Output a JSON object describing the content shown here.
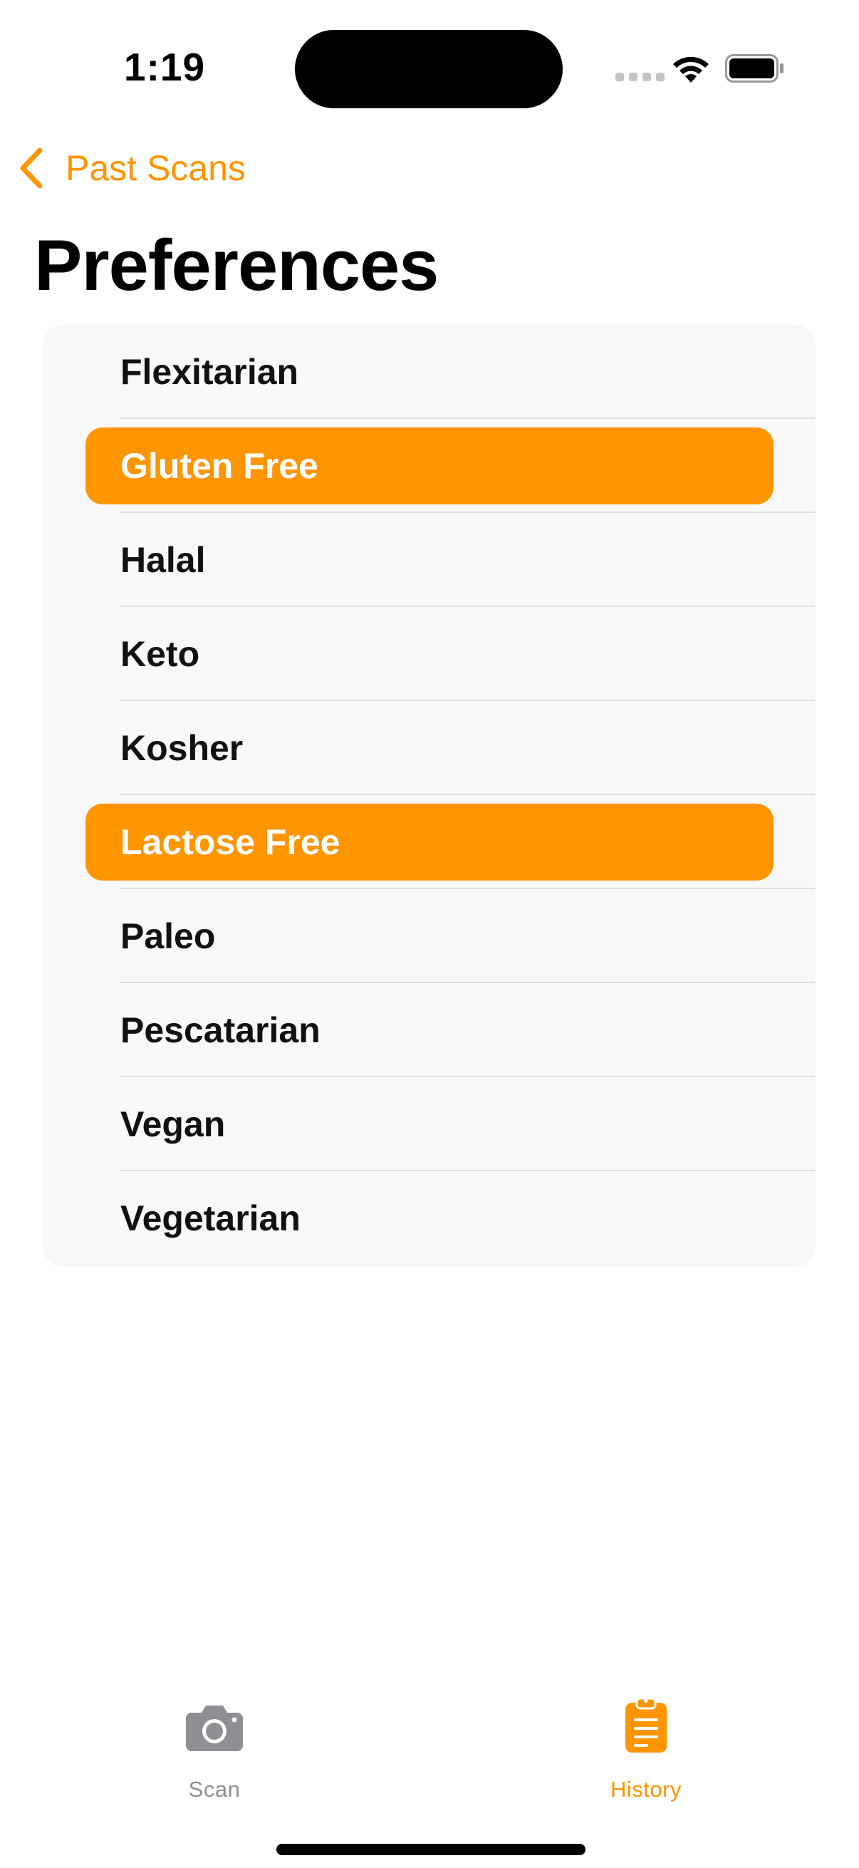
{
  "status_bar": {
    "time": "1:19"
  },
  "navigation": {
    "back_label": "Past Scans",
    "title": "Preferences"
  },
  "preferences": [
    {
      "label": "Flexitarian",
      "selected": false
    },
    {
      "label": "Gluten Free",
      "selected": true
    },
    {
      "label": "Halal",
      "selected": false
    },
    {
      "label": "Keto",
      "selected": false
    },
    {
      "label": "Kosher",
      "selected": false
    },
    {
      "label": "Lactose Free",
      "selected": true
    },
    {
      "label": "Paleo",
      "selected": false
    },
    {
      "label": "Pescatarian",
      "selected": false
    },
    {
      "label": "Vegan",
      "selected": false
    },
    {
      "label": "Vegetarian",
      "selected": false
    }
  ],
  "tab_bar": {
    "tabs": [
      {
        "label": "Scan",
        "icon": "camera-icon",
        "active": false
      },
      {
        "label": "History",
        "icon": "clipboard-icon",
        "active": true
      }
    ]
  },
  "colors": {
    "accent": "#ff9500",
    "inactive": "#8e8e93",
    "list_background": "#f8f8f8",
    "separator": "#dedede"
  }
}
